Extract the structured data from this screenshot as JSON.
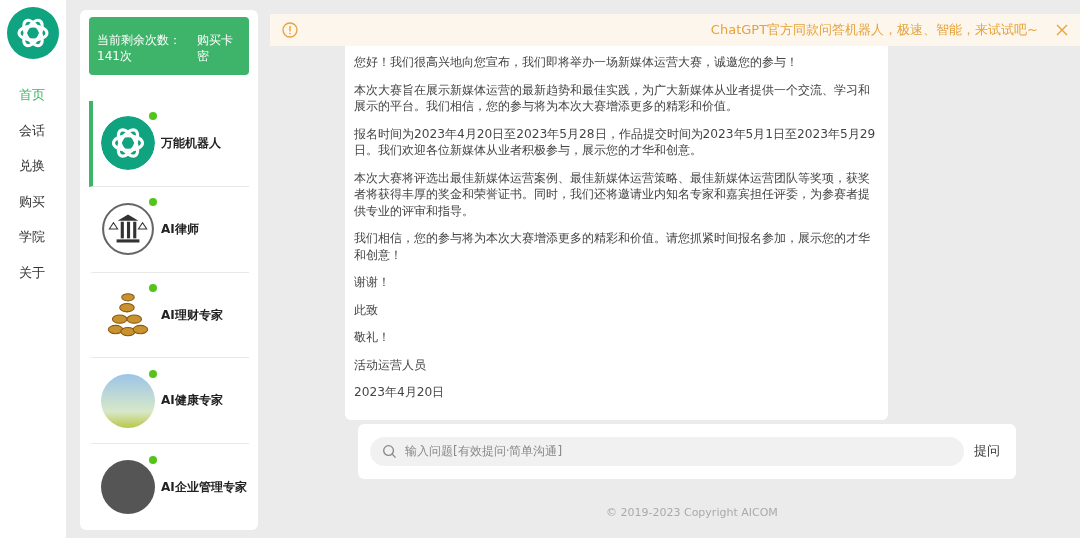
{
  "nav": {
    "items": [
      {
        "label": "首页",
        "selected": true
      },
      {
        "label": "会话",
        "selected": false
      },
      {
        "label": "兑换",
        "selected": false
      },
      {
        "label": "购买",
        "selected": false
      },
      {
        "label": "学院",
        "selected": false
      },
      {
        "label": "关于",
        "selected": false
      }
    ]
  },
  "quota": {
    "label": "当前剩余次数：",
    "count": "141次",
    "buy": "购买卡密"
  },
  "bots": [
    {
      "name": "万能机器人",
      "kind": "logo",
      "online": true,
      "selected": true
    },
    {
      "name": "AI律师",
      "kind": "scales",
      "online": true,
      "selected": false
    },
    {
      "name": "AI理财专家",
      "kind": "coins",
      "online": true,
      "selected": false
    },
    {
      "name": "AI健康专家",
      "kind": "photo",
      "online": true,
      "selected": false
    },
    {
      "name": "AI企业管理专家",
      "kind": "portrait",
      "online": true,
      "selected": false
    }
  ],
  "banner": {
    "text": "ChatGPT官方同款问答机器人，极速、智能，来试试吧~"
  },
  "message": {
    "paragraphs": [
      "您好！我们很高兴地向您宣布，我们即将举办一场新媒体运营大赛，诚邀您的参与！",
      "本次大赛旨在展示新媒体运营的最新趋势和最佳实践，为广大新媒体从业者提供一个交流、学习和展示的平台。我们相信，您的参与将为本次大赛增添更多的精彩和价值。",
      "报名时间为2023年4月20日至2023年5月28日，作品提交时间为2023年5月1日至2023年5月29日。我们欢迎各位新媒体从业者积极参与，展示您的才华和创意。",
      "本次大赛将评选出最佳新媒体运营案例、最佳新媒体运营策略、最佳新媒体运营团队等奖项，获奖者将获得丰厚的奖金和荣誉证书。同时，我们还将邀请业内知名专家和嘉宾担任评委，为参赛者提供专业的评审和指导。",
      "我们相信，您的参与将为本次大赛增添更多的精彩和价值。请您抓紧时间报名参加，展示您的才华和创意！",
      "谢谢！",
      "此致",
      "敬礼！",
      "活动运营人员",
      "2023年4月20日"
    ]
  },
  "input": {
    "placeholder": "输入问题[有效提问·简单沟通]",
    "submit": "提问"
  },
  "footer": "© 2019-2023 Copyright AICOM"
}
